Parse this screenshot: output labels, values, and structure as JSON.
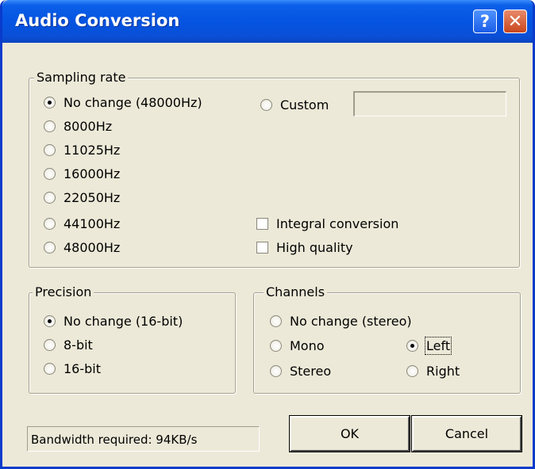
{
  "window": {
    "title": "Audio Conversion",
    "help_symbol": "?",
    "close_symbol": "✕",
    "colors": {
      "titlebar": "#0554e2",
      "face": "#ece9d8",
      "close": "#c8461c"
    }
  },
  "sampling_rate": {
    "legend": "Sampling rate",
    "options": [
      {
        "label": "No change (48000Hz)",
        "selected": true
      },
      {
        "label": "8000Hz",
        "selected": false
      },
      {
        "label": "11025Hz",
        "selected": false
      },
      {
        "label": "16000Hz",
        "selected": false
      },
      {
        "label": "22050Hz",
        "selected": false
      },
      {
        "label": "44100Hz",
        "selected": false
      },
      {
        "label": "48000Hz",
        "selected": false
      }
    ],
    "custom": {
      "label": "Custom",
      "selected": false,
      "value": ""
    },
    "integral_conversion": {
      "label": "Integral conversion",
      "checked": false
    },
    "high_quality": {
      "label": "High quality",
      "checked": false
    }
  },
  "precision": {
    "legend": "Precision",
    "options": [
      {
        "label": "No change (16-bit)",
        "selected": true
      },
      {
        "label": "8-bit",
        "selected": false
      },
      {
        "label": "16-bit",
        "selected": false
      }
    ]
  },
  "channels": {
    "legend": "Channels",
    "no_change": {
      "label": "No change (stereo)",
      "selected": false
    },
    "mono": {
      "label": "Mono",
      "selected": false
    },
    "stereo": {
      "label": "Stereo",
      "selected": false
    },
    "left": {
      "label": "Left",
      "selected": true
    },
    "right": {
      "label": "Right",
      "selected": false
    }
  },
  "status": {
    "text": "Bandwidth required: 94KB/s"
  },
  "buttons": {
    "ok": "OK",
    "cancel": "Cancel"
  }
}
